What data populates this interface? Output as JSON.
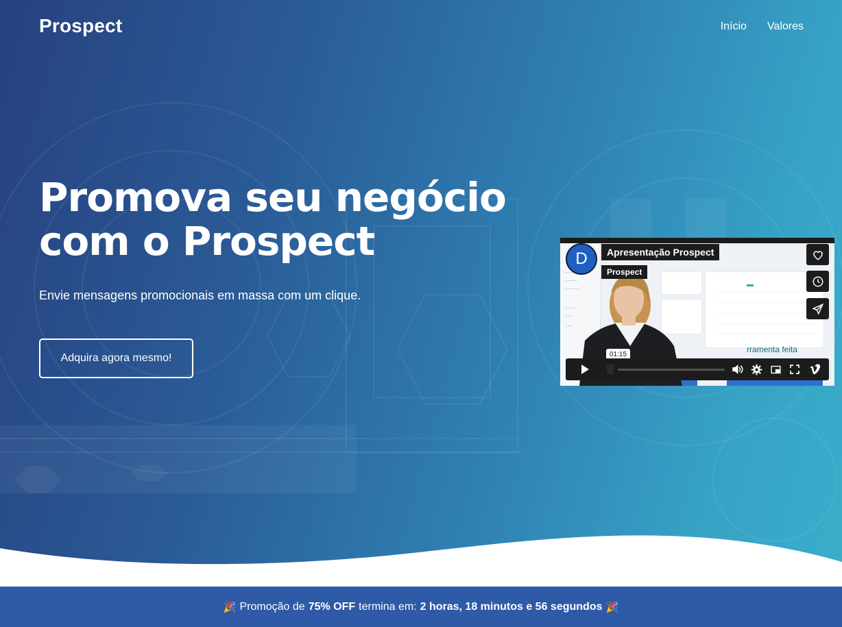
{
  "brand": "Prospect",
  "nav": {
    "items": [
      "Início",
      "Valores"
    ]
  },
  "hero": {
    "headline": "Promova seu negócio com o Prospect",
    "subtitle": "Envie mensagens promocionais em massa com um clique.",
    "cta_label": "Adquira agora mesmo!"
  },
  "video": {
    "avatar_letter": "D",
    "title": "Apresentação Prospect",
    "channel": "Prospect",
    "current_time": "01:15",
    "overlay_text": "rramenta feita",
    "side_buttons": [
      "heart-icon",
      "clock-icon",
      "send-icon"
    ],
    "controls": [
      "play-icon",
      "volume-icon",
      "settings-icon",
      "pip-icon",
      "fullscreen-icon",
      "vimeo-logo-icon"
    ]
  },
  "promo": {
    "emoji": "🎉",
    "prefix": "Promoção de",
    "discount": "75% OFF",
    "middle": "termina em:",
    "countdown": "2 horas, 18 minutos e 56 segundos"
  },
  "colors": {
    "hero_gradient_start": "#27417f",
    "hero_gradient_end": "#3aaecb",
    "promo_bar": "#2e5aa7",
    "player_chrome": "#1c1c1c"
  }
}
